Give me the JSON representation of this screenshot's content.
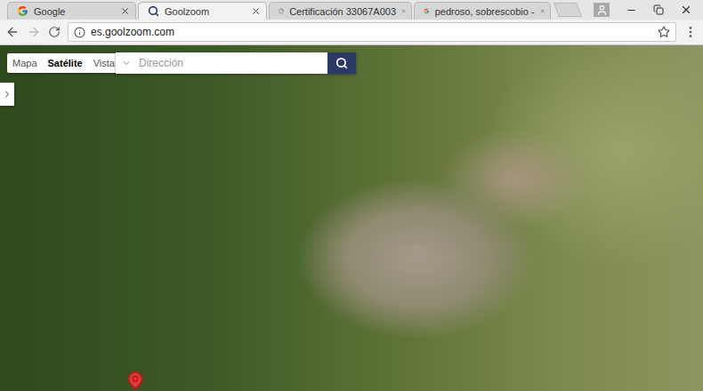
{
  "browser": {
    "tabs": [
      {
        "label": "Google",
        "icon": "google",
        "selected": false
      },
      {
        "label": "Goolzoom",
        "icon": "goolzoom",
        "selected": true
      },
      {
        "label": "Certificación 33067A003",
        "icon": "document",
        "selected": false
      },
      {
        "label": "pedroso, sobrescobio - ",
        "icon": "google",
        "selected": false
      }
    ],
    "address": "es.goolzoom.com"
  },
  "map": {
    "view_modes": [
      {
        "label": "Mapa",
        "selected": false
      },
      {
        "label": "Satélite",
        "selected": true
      },
      {
        "label": "Vista",
        "selected": false
      }
    ],
    "search": {
      "placeholder": "Dirección"
    }
  }
}
